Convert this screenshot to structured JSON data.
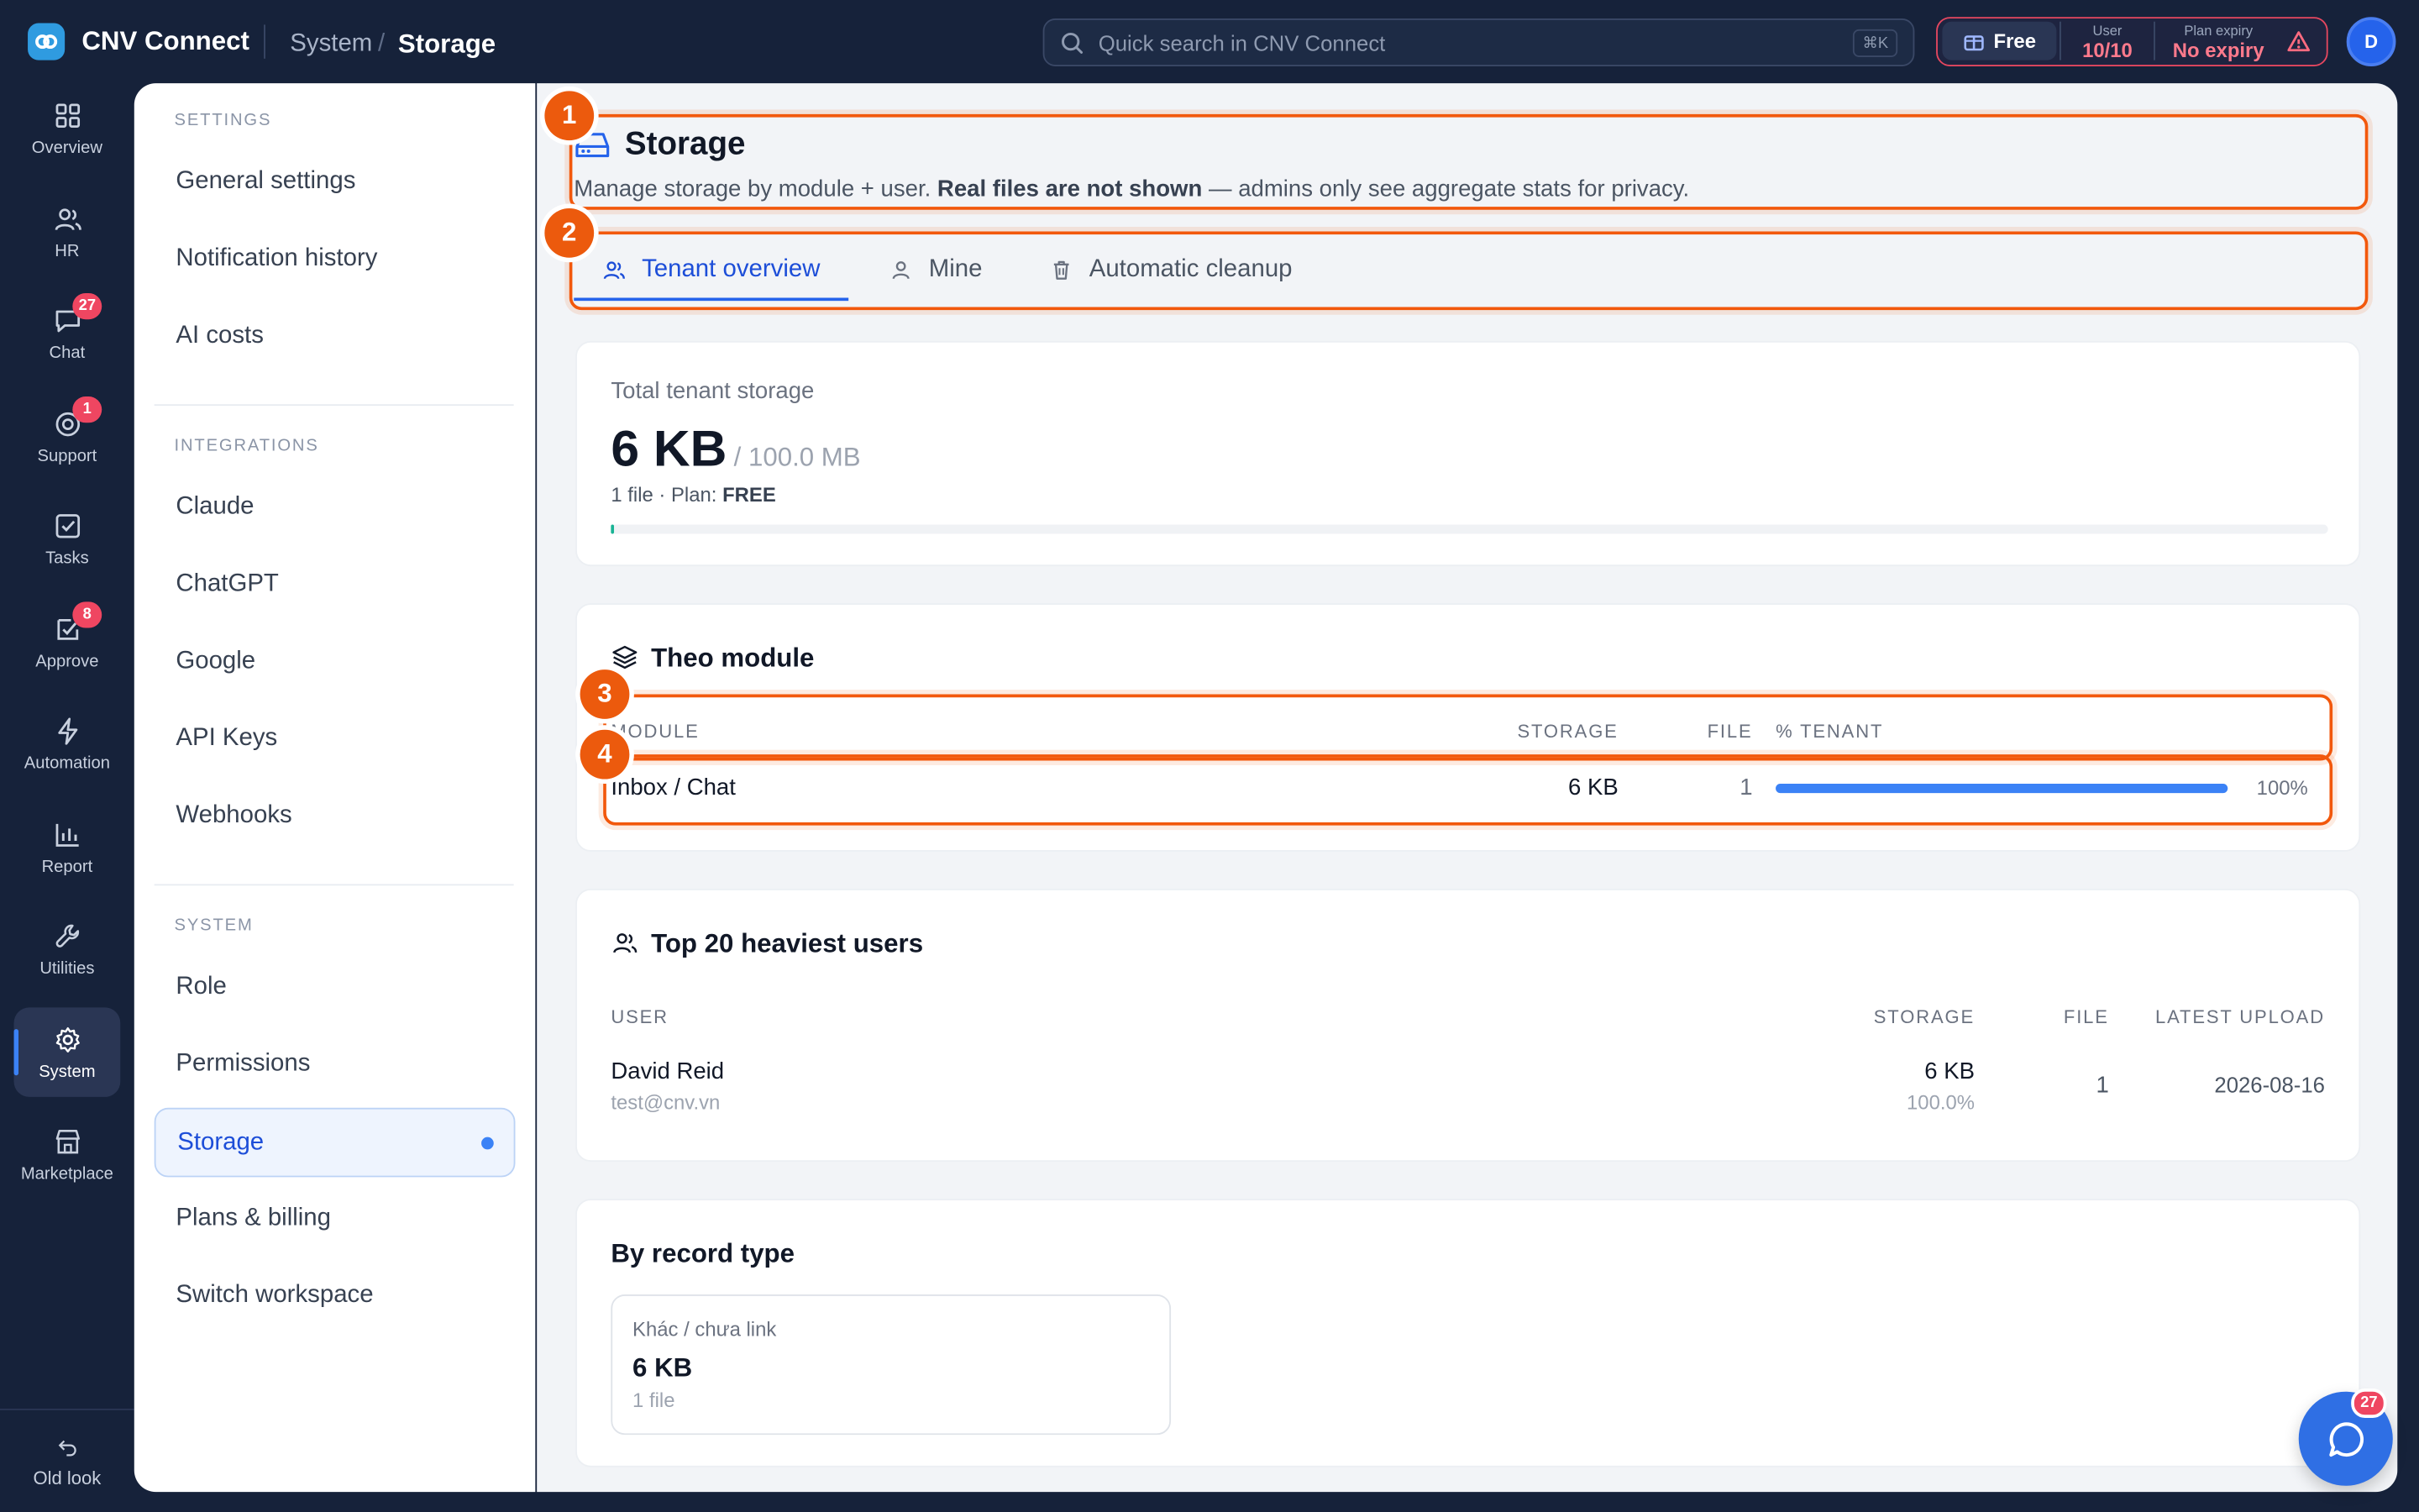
{
  "app": {
    "name": "CNV Connect"
  },
  "breadcrumb": {
    "parent": "System",
    "sep": "/",
    "current": "Storage"
  },
  "search": {
    "placeholder": "Quick search in CNV Connect",
    "shortcut": "⌘K"
  },
  "plan": {
    "name": "Free",
    "user_label": "User",
    "user_value": "10/10",
    "expiry_label": "Plan expiry",
    "expiry_value": "No expiry"
  },
  "user": {
    "initial": "D"
  },
  "rail": {
    "items": [
      {
        "label": "Overview",
        "icon": "grid-icon"
      },
      {
        "label": "HR",
        "icon": "users-icon"
      },
      {
        "label": "Chat",
        "icon": "chat-icon",
        "badge": "27"
      },
      {
        "label": "Support",
        "icon": "support-icon",
        "badge": "1"
      },
      {
        "label": "Tasks",
        "icon": "check-square-icon"
      },
      {
        "label": "Approve",
        "icon": "approve-icon",
        "badge": "8"
      },
      {
        "label": "Automation",
        "icon": "bolt-icon"
      },
      {
        "label": "Report",
        "icon": "bar-chart-icon"
      },
      {
        "label": "Utilities",
        "icon": "wrench-icon"
      },
      {
        "label": "System",
        "icon": "gear-icon"
      },
      {
        "label": "Marketplace",
        "icon": "store-icon"
      }
    ],
    "old_look": "Old look"
  },
  "settings": {
    "section_settings": "SETTINGS",
    "settings_items": [
      "General settings",
      "Notification history",
      "AI costs"
    ],
    "section_integrations": "INTEGRATIONS",
    "integration_items": [
      "Claude",
      "ChatGPT",
      "Google",
      "API Keys",
      "Webhooks"
    ],
    "section_system": "SYSTEM",
    "system_items": [
      "Role",
      "Permissions",
      "Storage",
      "Plans & billing",
      "Switch workspace"
    ]
  },
  "page": {
    "title": "Storage",
    "desc_pre": "Manage storage by module + user. ",
    "desc_bold": "Real files are not shown",
    "desc_post": " — admins only see aggregate stats for privacy.",
    "tabs": [
      "Tenant overview",
      "Mine",
      "Automatic cleanup"
    ]
  },
  "annotations": [
    "1",
    "2",
    "3",
    "4"
  ],
  "total": {
    "label": "Total tenant storage",
    "value": "6 KB",
    "limit": "/ 100.0 MB",
    "meta_pre": "1 file · Plan: ",
    "meta_plan": "FREE",
    "usage_fraction": 0.0001
  },
  "by_module": {
    "title": "Theo module",
    "columns": [
      "MODULE",
      "STORAGE",
      "FILE",
      "% TENANT"
    ],
    "rows": [
      {
        "module": "Inbox / Chat",
        "storage": "6 KB",
        "files": "1",
        "share": "100%",
        "share_fraction": 1.0
      }
    ]
  },
  "top_users": {
    "title": "Top 20 heaviest users",
    "columns": [
      "USER",
      "STORAGE",
      "FILE",
      "LATEST UPLOAD"
    ],
    "rows": [
      {
        "name": "David Reid",
        "email": "test@cnv.vn",
        "storage": "6 KB",
        "share": "100.0%",
        "files": "1",
        "latest": "2026-08-16"
      }
    ]
  },
  "record_type": {
    "title": "By record type",
    "items": [
      {
        "label": "Khác / chưa link",
        "value": "6 KB",
        "files": "1 file"
      }
    ]
  },
  "chat_fab": {
    "badge": "27"
  },
  "colors": {
    "accent": "#2563eb",
    "annotation": "#f2580c",
    "badge": "#ef4661",
    "sidebar": "#16223a"
  }
}
